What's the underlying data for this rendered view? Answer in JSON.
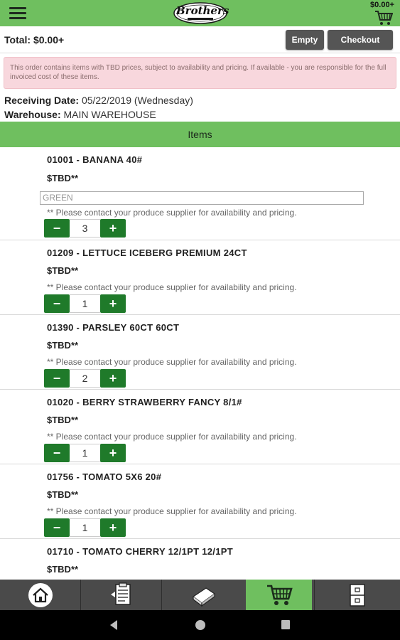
{
  "appbar": {
    "logo_text": "Brothers",
    "cart_total": "$0.00+",
    "menu_icon": "hamburger-menu-icon",
    "cart_icon": "shopping-cart-icon"
  },
  "totalbar": {
    "total": "Total:  $0.00+",
    "empty_label": "Empty",
    "checkout_label": "Checkout"
  },
  "alert": {
    "text": "This order contains items with TBD prices, subject to availability and pricing. If available - you are responsible for the full invoiced cost of these items."
  },
  "order": {
    "receiving_label": "Receiving Date:",
    "receiving_value": "05/22/2019 (Wednesday)",
    "warehouse_label": "Warehouse:",
    "warehouse_value": "MAIN WAREHOUSE"
  },
  "items_header": "Items",
  "items": [
    {
      "title": "01001 - BANANA 40#",
      "price": "$TBD**",
      "note_input": "GREEN",
      "note": "** Please contact your produce supplier for availability and pricing.",
      "qty": "3"
    },
    {
      "title": "01209 - LETTUCE ICEBERG PREMIUM 24CT",
      "price": "$TBD**",
      "note": "** Please contact your produce supplier for availability and pricing.",
      "qty": "1"
    },
    {
      "title": "01390 - PARSLEY 60CT 60CT",
      "price": "$TBD**",
      "note": "** Please contact your produce supplier for availability and pricing.",
      "qty": "2"
    },
    {
      "title": "01020 - BERRY STRAWBERRY FANCY 8/1#",
      "price": "$TBD**",
      "note": "** Please contact your produce supplier for availability and pricing.",
      "qty": "1"
    },
    {
      "title": "01756 - TOMATO 5X6 20#",
      "price": "$TBD**",
      "note": "** Please contact your produce supplier for availability and pricing.",
      "qty": "1"
    },
    {
      "title": "01710 - TOMATO CHERRY 12/1PT 12/1PT",
      "price": "$TBD**"
    }
  ],
  "stepper": {
    "minus": "−",
    "plus": "+"
  },
  "tabbar": {
    "tabs": [
      "home-icon",
      "order-guide-icon",
      "catalog-icon",
      "cart-icon",
      "account-icon"
    ],
    "active": "cart-icon"
  },
  "navbar": [
    "back-icon",
    "home-circle-icon",
    "recents-icon"
  ],
  "colors": {
    "green": "#6fbf5f",
    "dark_green": "#1f7a2a",
    "alert_bg": "#f8d7dd",
    "button_gray": "#555555"
  }
}
